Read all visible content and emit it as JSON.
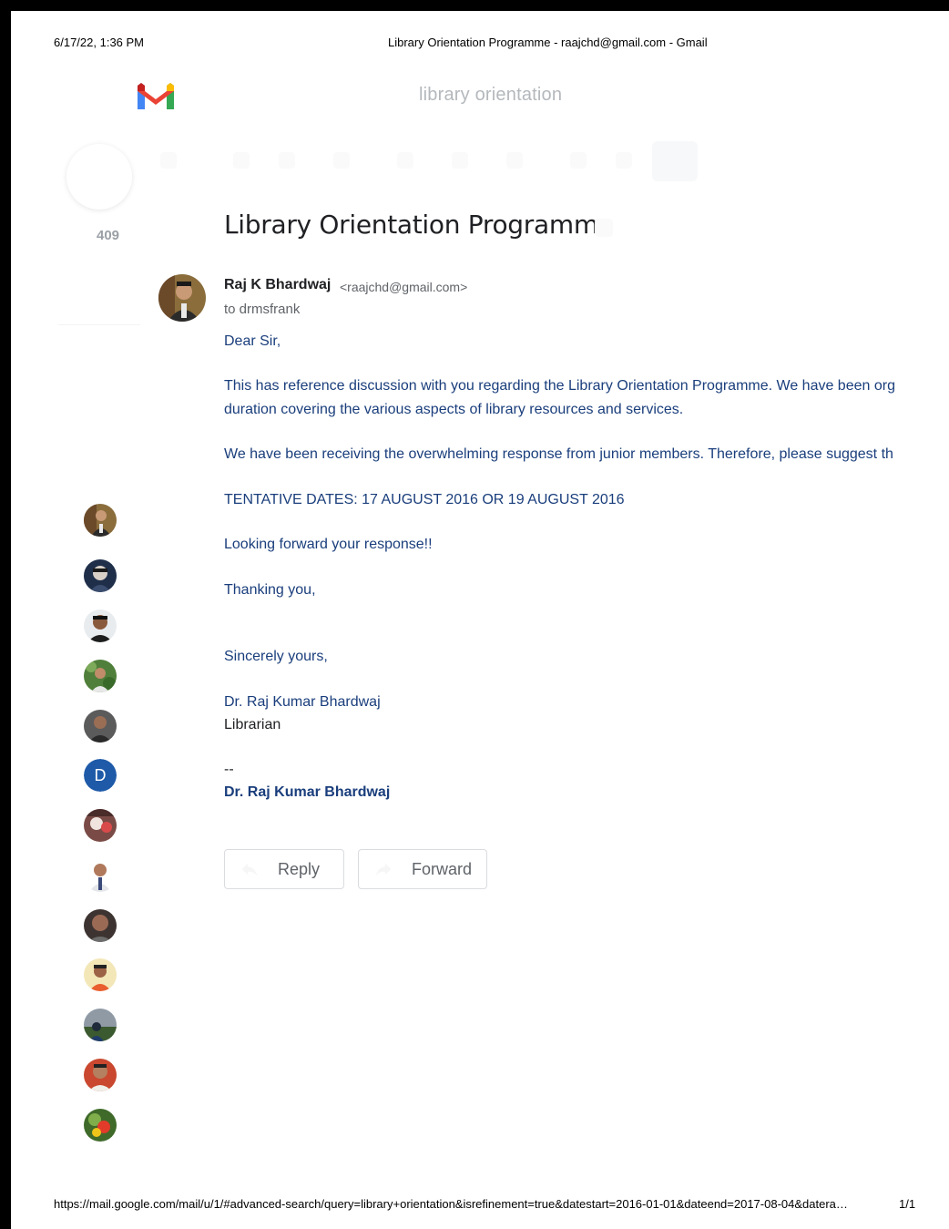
{
  "print_header": {
    "datetime": "6/17/22, 1:36 PM",
    "page_title": "Library Orientation Programme - raajchd@gmail.com - Gmail"
  },
  "gmail": {
    "search_query": "library orientation",
    "inbox_count": "409"
  },
  "email": {
    "subject": "Library Orientation Programme",
    "sender_name": "Raj K Bhardwaj",
    "sender_email": "<raajchd@gmail.com>",
    "recipient": "to drmsfrank",
    "greeting": "Dear Sir,",
    "para1_line1": "This has reference discussion with you regarding the Library Orientation Programme. We have been org",
    "para1_line2": "duration covering the various aspects of library resources and services.",
    "para2": "We have been receiving the overwhelming response from junior members. Therefore, please suggest th",
    "dates": "TENTATIVE DATES: 17 AUGUST 2016 OR 19 AUGUST 2016",
    "looking_forward": "Looking forward your response!!",
    "thanking": "Thanking you,",
    "closing": "Sincerely yours,",
    "sig_name": "Dr. Raj Kumar Bhardwaj",
    "sig_title": "Librarian",
    "sig_separator": "--",
    "sig_bold_name": "Dr. Raj Kumar Bhardwaj"
  },
  "actions": {
    "reply_label": "Reply",
    "forward_label": "Forward"
  },
  "contacts": {
    "letter_avatar": "D",
    "letter_avatar_color": "#1e5aa8"
  },
  "print_footer": {
    "url": "https://mail.google.com/mail/u/1/#advanced-search/query=library+orientation&isrefinement=true&datestart=2016-01-01&dateend=2017-08-04&datera…",
    "page_number": "1/1"
  }
}
